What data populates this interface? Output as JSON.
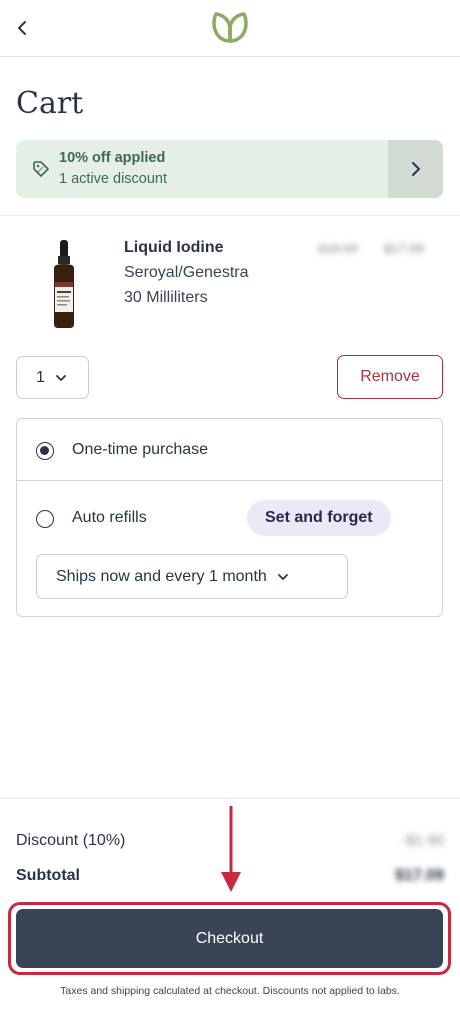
{
  "header": {
    "back_icon": "chevron-left-icon",
    "logo_icon": "leaf-logo-icon"
  },
  "page": {
    "title": "Cart"
  },
  "discount_banner": {
    "title": "10% off applied",
    "subtitle": "1 active discount",
    "icon": "tag-icon",
    "chevron_icon": "chevron-right-icon"
  },
  "cart_item": {
    "name": "Liquid Iodine",
    "brand": "Seroyal/Genestra",
    "size": "30 Milliliters",
    "original_price": "$18.99",
    "price": "$17.09",
    "quantity": "1",
    "remove_label": "Remove"
  },
  "purchase_options": {
    "one_time_label": "One-time purchase",
    "one_time_selected": true,
    "auto_refills_label": "Auto refills",
    "auto_refills_selected": false,
    "badge": "Set and forget",
    "frequency": "Ships now and every 1 month"
  },
  "summary": {
    "discount_label": "Discount (10%)",
    "discount_value": "-$1.90",
    "subtotal_label": "Subtotal",
    "subtotal_value": "$17.09"
  },
  "checkout": {
    "label": "Checkout",
    "note": "Taxes and shipping calculated at checkout. Discounts not applied to labs."
  },
  "colors": {
    "primary": "#394457",
    "accent_red": "#c8293f",
    "discount_bg": "#e5efe8",
    "badge_bg": "#ece8f7",
    "logo_green": "#8aac5e"
  }
}
